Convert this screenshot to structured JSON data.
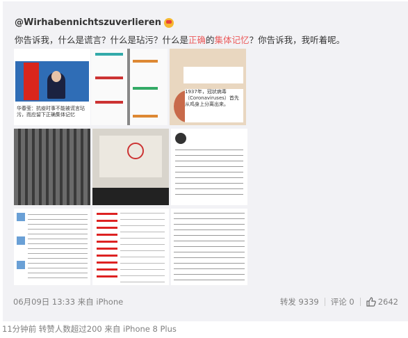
{
  "post": {
    "username": "@Wirhabennichtszuverlieren",
    "text_parts": [
      "你告诉我，什么是谎言？什么是玷污？什么是",
      "正确",
      "的",
      "集体记忆",
      "？你告诉我，我听着呢。"
    ],
    "images": [
      {
        "caption": "华春莹：抗疫时事不能被谎言玷污，而应留下正确集体记忆"
      },
      {
        "caption": ""
      },
      {
        "caption": "1937年，冠状病毒（Coronaviruses）首先从鸡身上分离出来。"
      },
      {
        "caption": ""
      },
      {
        "caption": ""
      },
      {
        "caption": ""
      },
      {
        "caption": ""
      },
      {
        "caption": ""
      },
      {
        "caption": ""
      }
    ],
    "timestamp": "06月09日 13:33 来自 iPhone",
    "repost_label": "转发 9339",
    "comment_label": "评论 0",
    "like_count": "2642"
  },
  "footer": "11分钟前 转赞人数超过200  来自 iPhone 8 Plus",
  "colors": {
    "highlight": "#eb5b5b",
    "card_bg": "#f2f2f5"
  }
}
